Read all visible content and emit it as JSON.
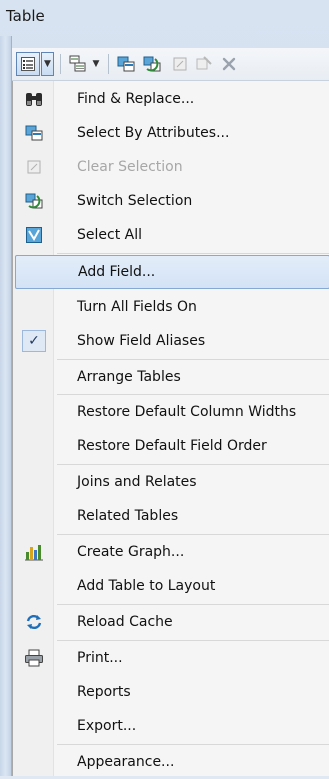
{
  "window": {
    "title": "Table"
  },
  "toolbar": {
    "buttons": [
      {
        "name": "table-options-icon",
        "has_dropdown": true
      },
      {
        "name": "related-tables-icon",
        "has_dropdown": true
      },
      {
        "name": "select-by-attributes-icon"
      },
      {
        "name": "switch-selection-icon"
      },
      {
        "name": "clear-selection-icon"
      },
      {
        "name": "delete-selected-icon"
      },
      {
        "name": "close-icon"
      }
    ]
  },
  "menu": {
    "items": [
      {
        "id": "find-replace",
        "label": "Find & Replace...",
        "icon": "binoculars-icon"
      },
      {
        "id": "select-by-attributes",
        "label": "Select By Attributes...",
        "icon": "select-by-attributes-icon"
      },
      {
        "id": "clear-selection",
        "label": "Clear Selection",
        "icon": "clear-selection-icon",
        "disabled": true
      },
      {
        "id": "switch-selection",
        "label": "Switch Selection",
        "icon": "switch-selection-icon"
      },
      {
        "id": "select-all",
        "label": "Select All",
        "icon": "select-all-icon"
      },
      {
        "id": "add-field",
        "label": "Add Field...",
        "highlighted": true
      },
      {
        "id": "turn-all-fields-on",
        "label": "Turn All Fields On"
      },
      {
        "id": "show-field-aliases",
        "label": "Show Field Aliases",
        "checked": true
      },
      {
        "id": "arrange-tables",
        "label": "Arrange Tables"
      },
      {
        "id": "restore-column-widths",
        "label": "Restore Default Column Widths"
      },
      {
        "id": "restore-field-order",
        "label": "Restore Default Field Order"
      },
      {
        "id": "joins-relates",
        "label": "Joins and Relates"
      },
      {
        "id": "related-tables",
        "label": "Related Tables"
      },
      {
        "id": "create-graph",
        "label": "Create Graph...",
        "icon": "bar-chart-icon"
      },
      {
        "id": "add-table-to-layout",
        "label": "Add Table to Layout"
      },
      {
        "id": "reload-cache",
        "label": "Reload Cache",
        "icon": "refresh-icon"
      },
      {
        "id": "print",
        "label": "Print...",
        "icon": "printer-icon"
      },
      {
        "id": "reports",
        "label": "Reports"
      },
      {
        "id": "export",
        "label": "Export..."
      },
      {
        "id": "appearance",
        "label": "Appearance..."
      }
    ]
  },
  "colors": {
    "highlight": "#d3e3f6",
    "highlight_border": "#86a9d3",
    "disabled_text": "#a7a7a7",
    "menu_bg": "#f5f5f5"
  }
}
